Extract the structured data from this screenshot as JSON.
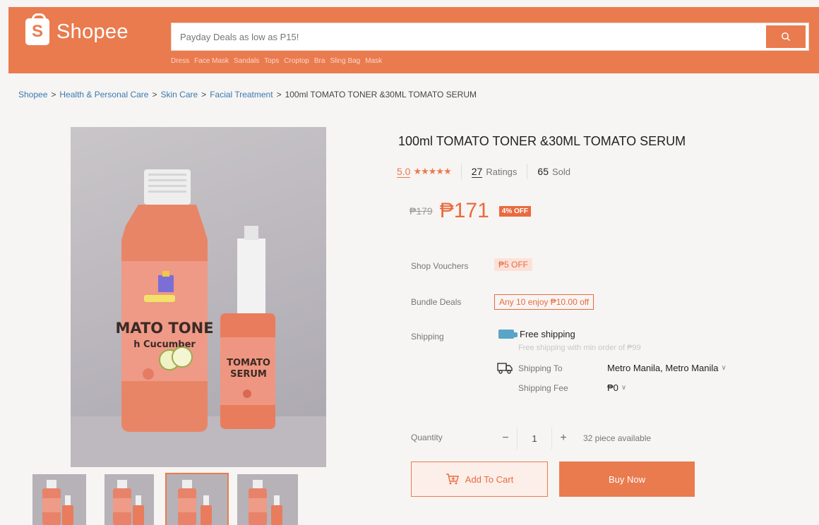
{
  "header": {
    "logo_letter": "S",
    "logo_text": "Shopee",
    "search_placeholder": "Payday Deals as low as P15!",
    "hot_words": [
      "Dress",
      "Face Mask",
      "Sandals",
      "Tops",
      "Croptop",
      "Bra",
      "Sling Bag",
      "Mask"
    ],
    "brand_color": "#ea7b4f"
  },
  "breadcrumb": {
    "items": [
      "Shopee",
      "Health & Personal Care",
      "Skin Care",
      "Facial Treatment",
      "100ml TOMATO TONER &30ML TOMATO SERUM"
    ],
    "separator": ">"
  },
  "product": {
    "title": "100ml TOMATO TONER &30ML TOMATO SERUM",
    "rating": "5.0",
    "stars": "★★★★★",
    "ratings_count": "27",
    "ratings_label": "Ratings",
    "sold_count": "65",
    "sold_label": "Sold",
    "old_price": "₱179",
    "price": "₱171",
    "discount": "4% OFF",
    "image_labels": {
      "toner_line1": "MATO TONE",
      "toner_line2": "h Cucumber",
      "serum_line1": "TOMATO",
      "serum_line2": "SERUM"
    }
  },
  "details": {
    "vouchers_label": "Shop Vouchers",
    "voucher": "₱5 OFF",
    "bundle_label": "Bundle Deals",
    "bundle": "Any 10 enjoy ₱10.00 off",
    "shipping_label": "Shipping",
    "free_shipping": "Free shipping",
    "free_shipping_sub": "Free shipping with min order of ₱99",
    "shipping_to_label": "Shipping To",
    "shipping_to": "Metro Manila, Metro Manila",
    "shipping_fee_label": "Shipping Fee",
    "shipping_fee": "₱0"
  },
  "quantity": {
    "label": "Quantity",
    "minus": "−",
    "value": "1",
    "plus": "+",
    "available": "32 piece available"
  },
  "actions": {
    "add_to_cart": "Add To Cart",
    "buy_now": "Buy Now"
  }
}
